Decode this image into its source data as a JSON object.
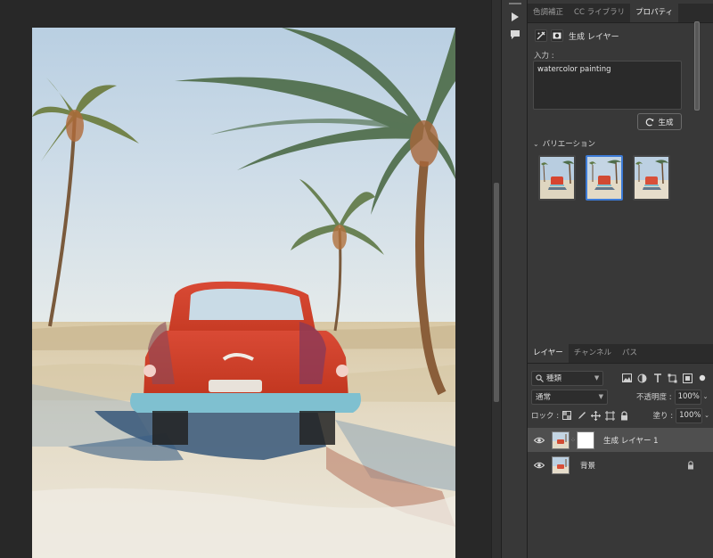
{
  "panel_tabs": {
    "items": [
      {
        "label": "色調補正",
        "active": false
      },
      {
        "label": "CC ライブラリ",
        "active": false
      },
      {
        "label": "プロパティ",
        "active": true
      }
    ]
  },
  "properties": {
    "title": "生成 レイヤー",
    "input_label": "入力 :",
    "prompt_value": "watercolor painting",
    "generate_label": "生成",
    "variations_label": "バリエーション",
    "variations": [
      {
        "selected": false
      },
      {
        "selected": true
      },
      {
        "selected": false
      }
    ]
  },
  "layers_tabs": {
    "items": [
      {
        "label": "レイヤー",
        "active": true
      },
      {
        "label": "チャンネル",
        "active": false
      },
      {
        "label": "パス",
        "active": false
      }
    ]
  },
  "layers": {
    "filter_kind": "種類",
    "blend_mode": "通常",
    "opacity_label": "不透明度 :",
    "opacity_value": "100%",
    "lock_label": "ロック :",
    "fill_label": "塗り :",
    "fill_value": "100%",
    "items": [
      {
        "name": "生成 レイヤー 1",
        "selected": true,
        "visible": true,
        "has_mask": true,
        "locked": false
      },
      {
        "name": "背景",
        "selected": false,
        "visible": true,
        "has_mask": false,
        "locked": true
      }
    ]
  },
  "colors": {
    "accent": "#3d7bd6",
    "panel_bg": "#383838",
    "app_bg": "#282828"
  },
  "icons": {
    "strip": [
      "panel-collapse-icon",
      "play-icon",
      "comment-icon"
    ],
    "header": [
      "generative-layer-icon",
      "mask-icon"
    ],
    "generate": "refresh-icon",
    "filter": [
      "image-filter-icon",
      "adjustment-filter-icon",
      "type-filter-icon",
      "shape-filter-icon",
      "smartobject-filter-icon",
      "filter-toggle-icon"
    ],
    "lock": [
      "lock-transparent-icon",
      "lock-paint-icon",
      "lock-position-icon",
      "lock-artboard-icon",
      "lock-all-icon"
    ]
  }
}
